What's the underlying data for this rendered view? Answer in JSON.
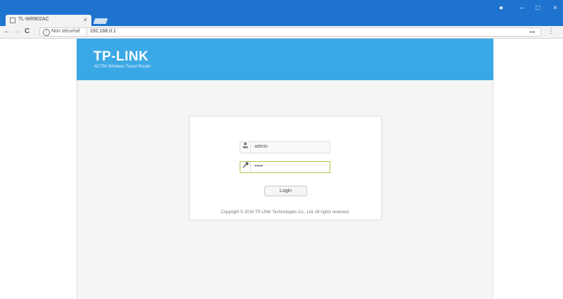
{
  "browser": {
    "tab_title": "TL-WR902AC",
    "tab_close": "×",
    "security_label": "Non sécurisé",
    "url": "192.168.0.1",
    "back_glyph": "←",
    "forward_glyph": "→",
    "reload_glyph": "C",
    "info_glyph": "i",
    "minimize_glyph": "–",
    "maximize_glyph": "□",
    "close_glyph": "×",
    "account_glyph": "●",
    "key_glyph": "⊶",
    "menu_glyph": "⋮"
  },
  "header": {
    "brand": "TP-LINK",
    "model": "AC750 Wireless Travel Router"
  },
  "login": {
    "username_value": "admin",
    "password_value": "•••••",
    "user_icon": "user-icon",
    "lock_icon": "key-icon",
    "button_label": "Login",
    "copyright": "Copyright © 2016 TP-LINK Technologies Co., Ltd. All rights reserved."
  },
  "colors": {
    "titlebar": "#1e73cf",
    "brandbar": "#3ba8e6",
    "password_border": "#a8c94c"
  }
}
